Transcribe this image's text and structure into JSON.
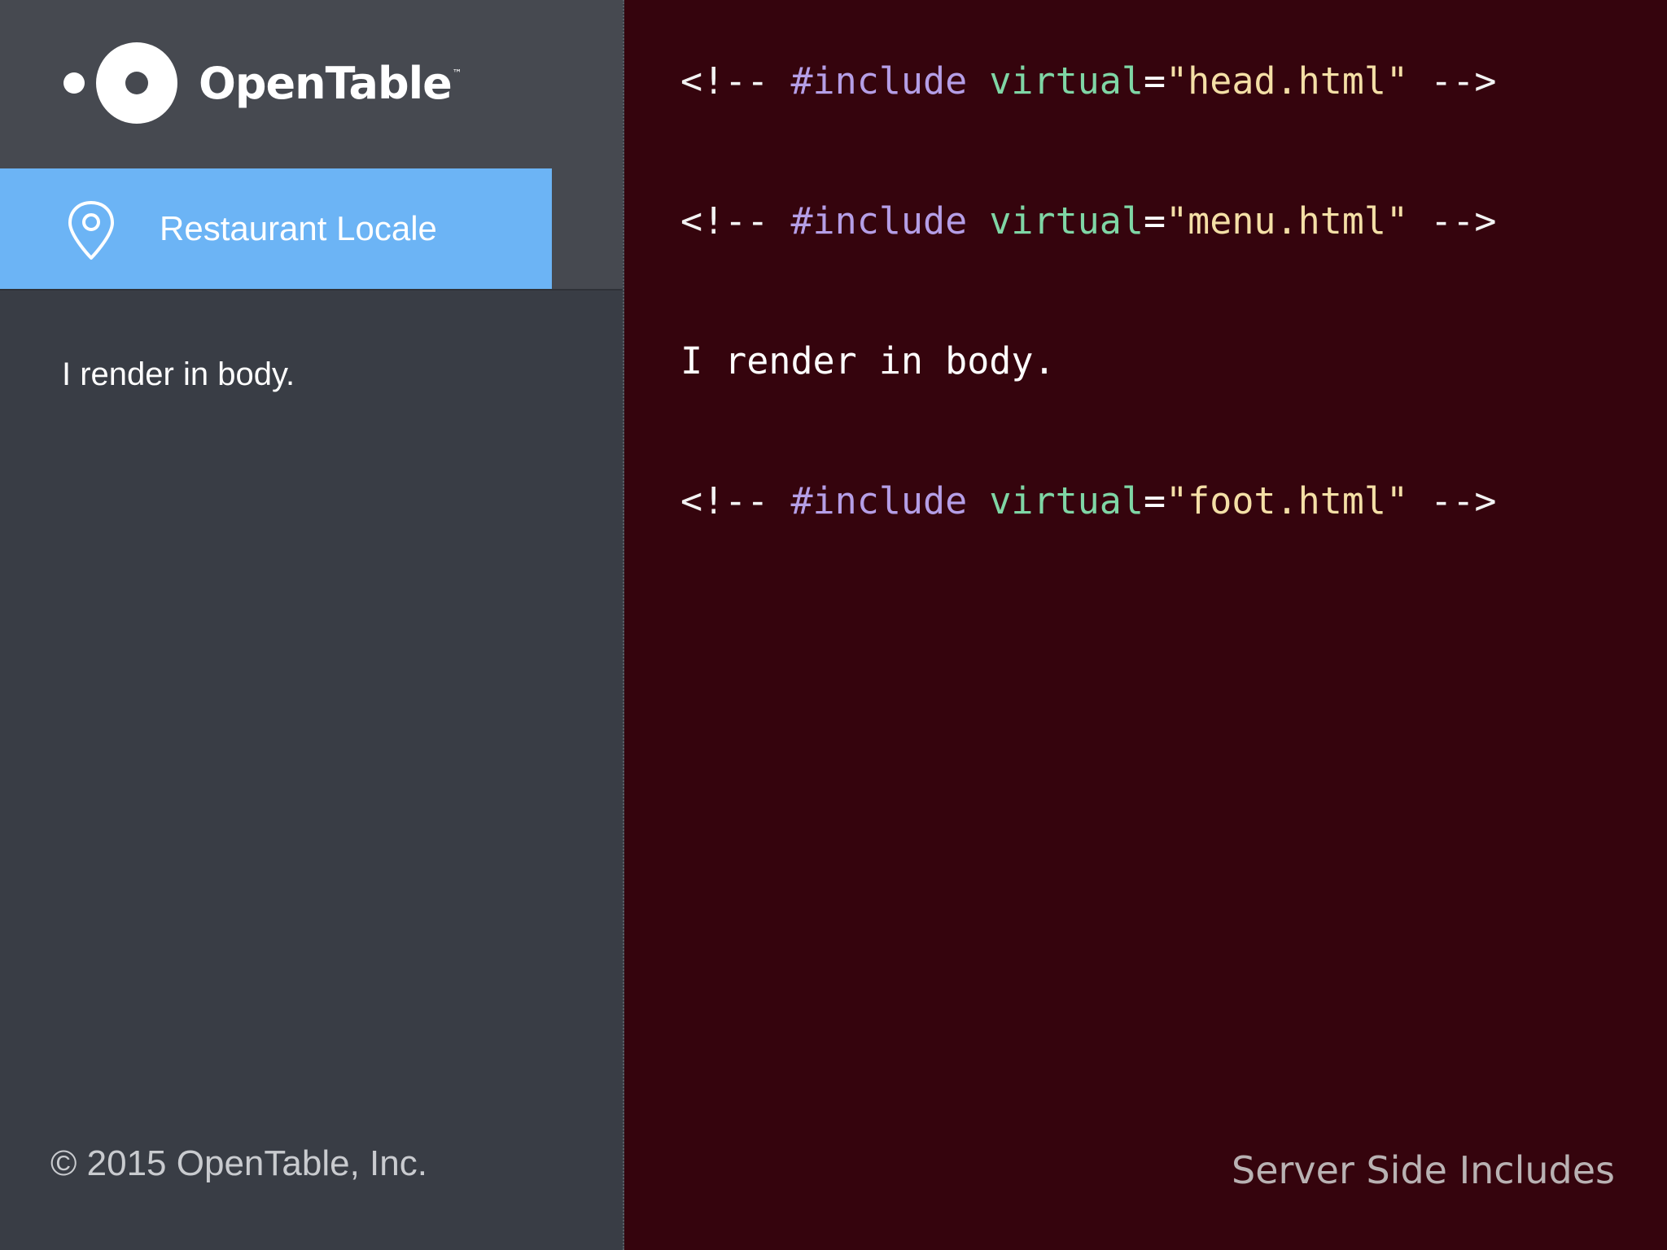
{
  "preview": {
    "brand": {
      "name": "OpenTable",
      "trademark": "™"
    },
    "menu": {
      "active_item": "Restaurant Locale",
      "active_color": "#6cb4f5",
      "icon": "map-pin-icon"
    },
    "body_text": "I render in body.",
    "footer_text": "© 2015 OpenTable, Inc."
  },
  "code": {
    "lines": [
      {
        "open": "<!-- ",
        "directive": "#include",
        "attr": "virtual",
        "eq": "=",
        "value": "\"head.html\"",
        "close": " -->"
      },
      {
        "open": "<!-- ",
        "directive": "#include",
        "attr": "virtual",
        "eq": "=",
        "value": "\"menu.html\"",
        "close": " -->"
      },
      {
        "plain": "I render in body."
      },
      {
        "open": "<!-- ",
        "directive": "#include",
        "attr": "virtual",
        "eq": "=",
        "value": "\"foot.html\"",
        "close": " -->"
      }
    ]
  },
  "caption": "Server Side Includes",
  "colors": {
    "code_background": "#35040d",
    "panel_background": "#393d45",
    "directive": "#b59ee6",
    "attribute": "#7fd6a5",
    "string": "#f4dfa6"
  }
}
